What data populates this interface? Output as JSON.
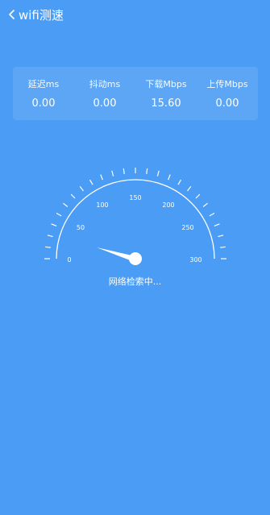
{
  "header": {
    "title": "wifi测速",
    "back_icon": "chevron-left-icon"
  },
  "stats": [
    {
      "label": "延迟ms",
      "value": "0.00"
    },
    {
      "label": "抖动ms",
      "value": "0.00"
    },
    {
      "label": "下载Mbps",
      "value": "15.60"
    },
    {
      "label": "上传Mbps",
      "value": "0.00"
    }
  ],
  "gauge": {
    "labels": [
      "0",
      "50",
      "100",
      "150",
      "200",
      "250",
      "300"
    ],
    "min": 0,
    "max": 300,
    "current_value": 0
  },
  "status_text": "网络检索中..."
}
